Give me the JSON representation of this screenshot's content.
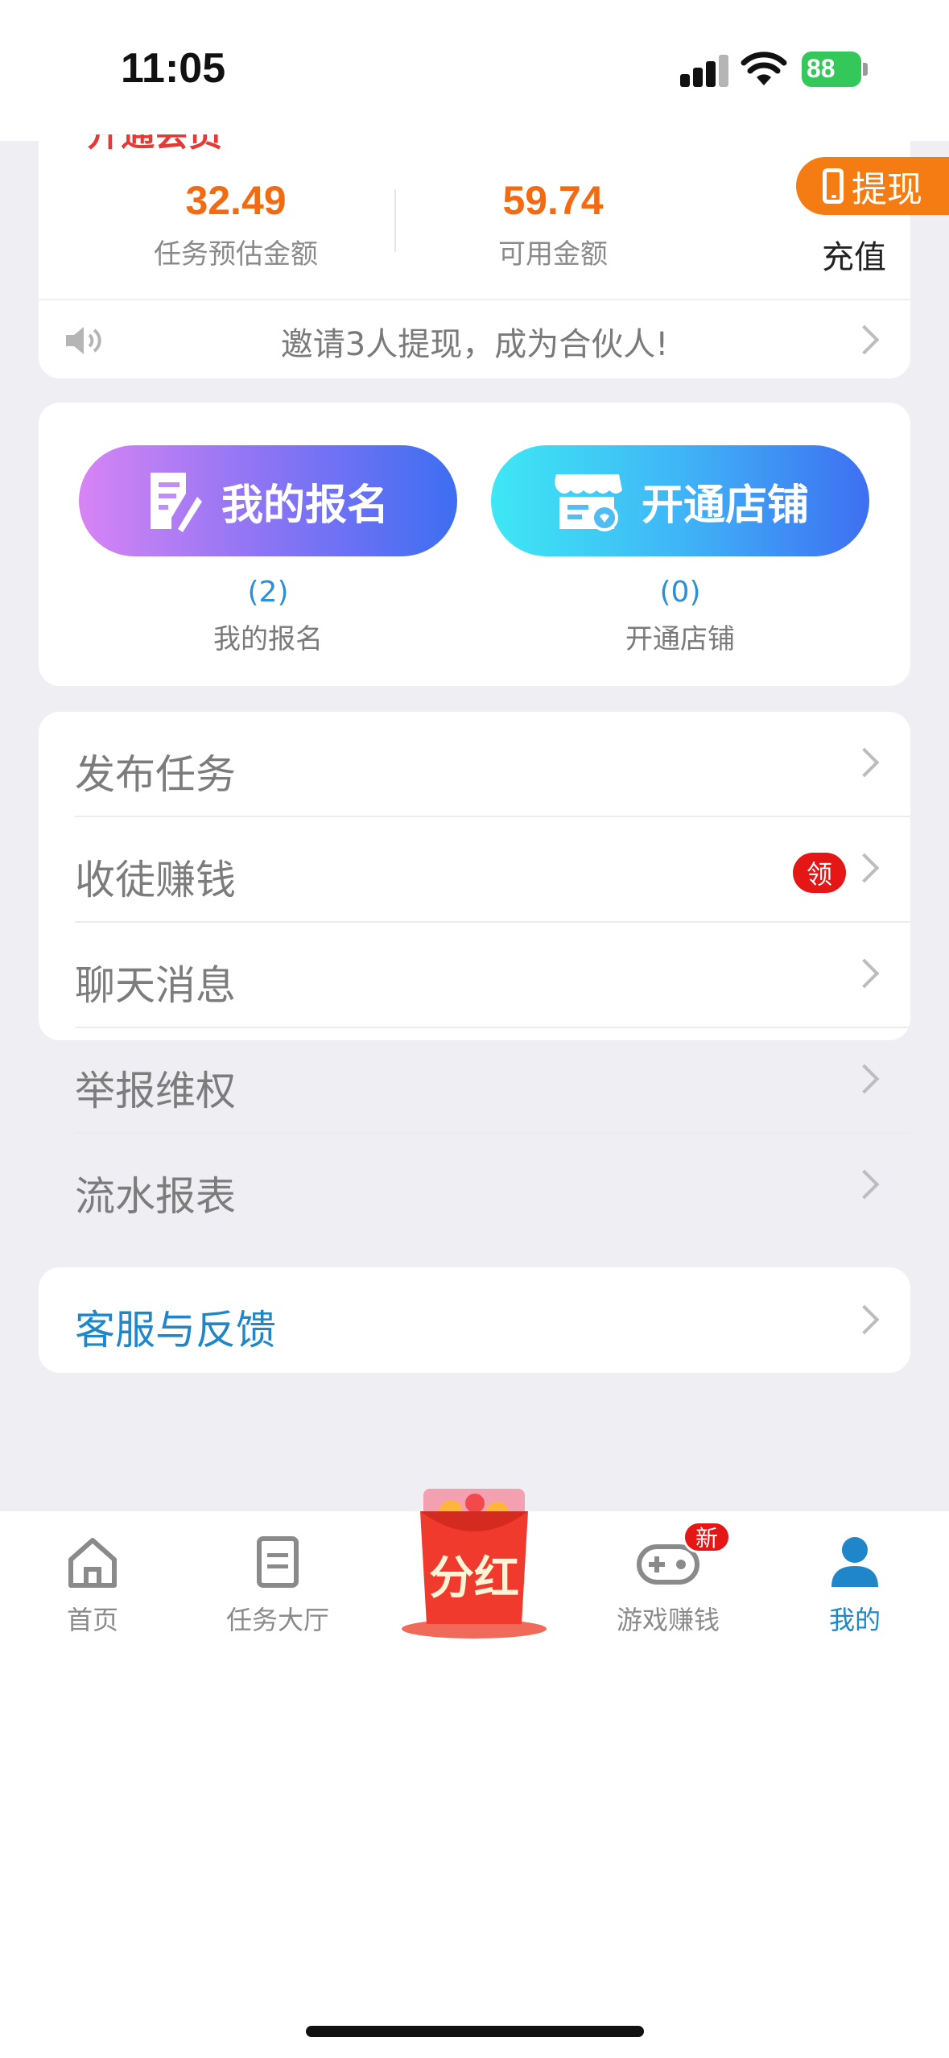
{
  "status_bar": {
    "time": "11:05",
    "battery": "88"
  },
  "wallet": {
    "title": "开通会员",
    "estimated_amount": "32.49",
    "estimated_label": "任务预估金额",
    "available_amount": "59.74",
    "available_label": "可用金额",
    "withdraw_label": "提现",
    "recharge_label": "充值",
    "notice": "邀请3人提现，成为合伙人!"
  },
  "actions": {
    "signup_button": "我的报名",
    "signup_count": "(2)",
    "signup_label": "我的报名",
    "shop_button": "开通店铺",
    "shop_count": "(0)",
    "shop_label": "开通店铺"
  },
  "menu": {
    "items": [
      {
        "label": "发布任务"
      },
      {
        "label": "收徒赚钱",
        "badge": "领"
      },
      {
        "label": "聊天消息"
      },
      {
        "label": "举报维权"
      },
      {
        "label": "流水报表"
      }
    ]
  },
  "support": {
    "label": "客服与反馈"
  },
  "tabbar": {
    "tabs": [
      {
        "label": "首页",
        "icon": "home-icon"
      },
      {
        "label": "任务大厅",
        "icon": "document-icon"
      },
      {
        "label": "分红",
        "icon": "red-envelope-icon"
      },
      {
        "label": "游戏赚钱",
        "icon": "gamepad-icon",
        "badge": "新"
      },
      {
        "label": "我的",
        "icon": "user-icon"
      }
    ],
    "active_color": "#1f87c9"
  },
  "colors": {
    "accent": "#f26a12",
    "link": "#1f87c9",
    "badge": "#e41616"
  }
}
